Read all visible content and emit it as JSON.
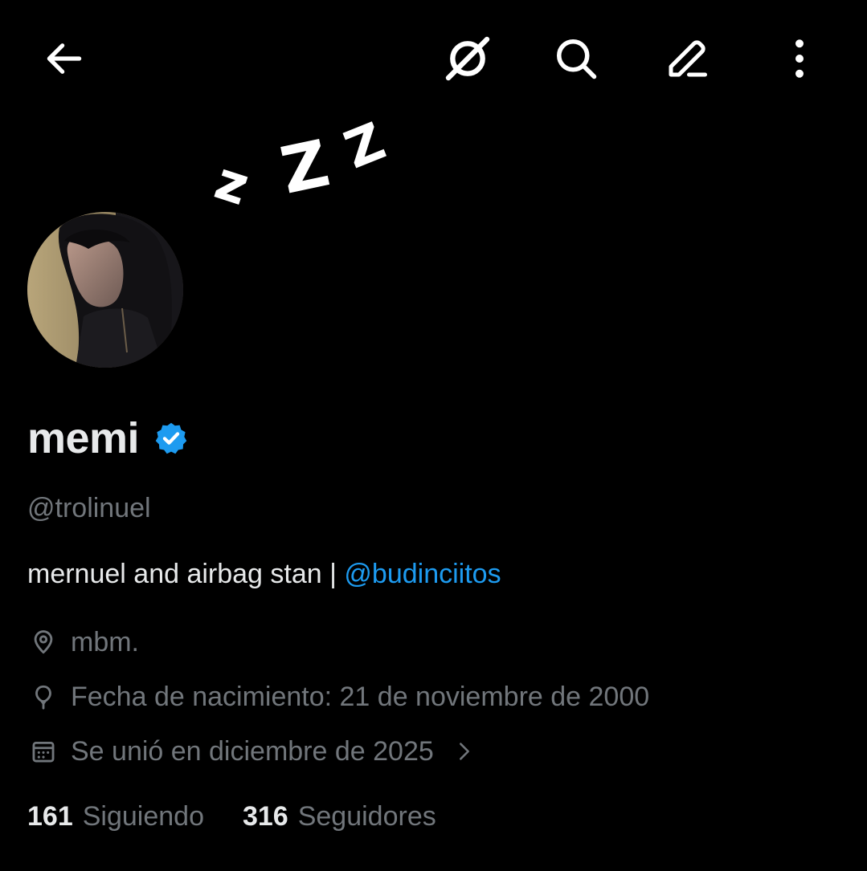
{
  "header": {
    "back_icon": "arrow-left-icon",
    "grok_icon": "grok-icon",
    "search_icon": "search-icon",
    "edit_icon": "edit-pencil-icon",
    "more_icon": "more-vertical-icon"
  },
  "banner": {
    "letters": [
      "z",
      "Z",
      "Z"
    ]
  },
  "profile": {
    "display_name": "memi",
    "verified": true,
    "handle": "@trolinuel",
    "bio_text": "mernuel and airbag stan | ",
    "bio_mention": "@budinciitos",
    "location": "mbm.",
    "birthday": "Fecha de nacimiento: 21 de noviembre de 2000",
    "joined": "Se unió en diciembre de 2025",
    "following_count": "161",
    "following_label": "Siguiendo",
    "followers_count": "316",
    "followers_label": "Seguidores"
  },
  "colors": {
    "background": "#000000",
    "primary_text": "#e7e9ea",
    "secondary_text": "#71767b",
    "accent": "#1d9bf0"
  }
}
